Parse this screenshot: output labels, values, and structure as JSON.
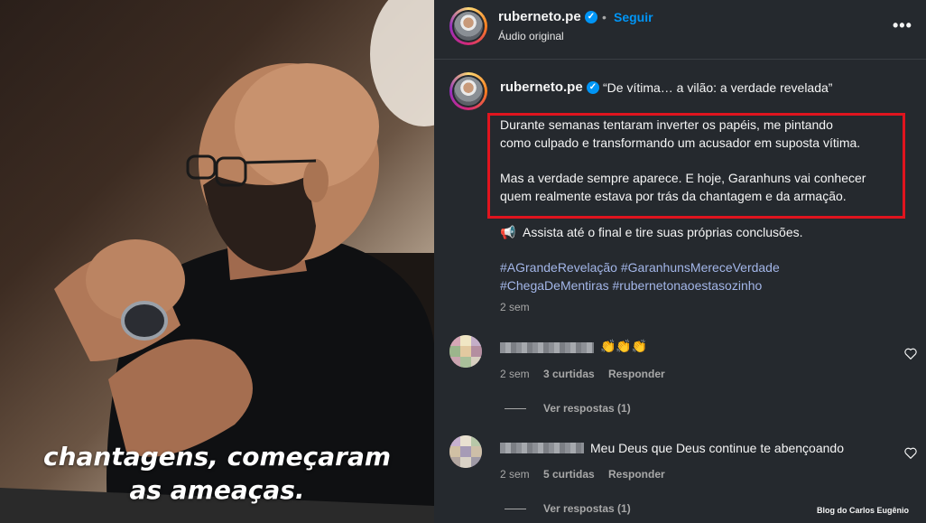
{
  "video": {
    "caption_line1": "chantagens, começaram",
    "caption_line2": "as ameaças."
  },
  "header": {
    "username": "ruberneto.pe",
    "verified_icon": "verified-badge-icon",
    "separator": "•",
    "follow_label": "Seguir",
    "audio_label": "Áudio original",
    "more_label": "•••"
  },
  "post": {
    "username": "ruberneto.pe",
    "title": "“De vítima… a vilão: a verdade revelada”",
    "paragraph1_line1": "Durante semanas tentaram inverter os papéis, me pintando",
    "paragraph1_line2": "como culpado e transformando um acusador em suposta vítima.",
    "paragraph2_line1": "Mas a verdade sempre aparece. E hoje, Garanhuns vai conhecer",
    "paragraph2_line2": "quem realmente estava por trás da chantagem e da armação.",
    "megaphone_icon": "📢",
    "cta": "Assista até o final e tire suas próprias conclusões.",
    "hashtags_line1": "#AGrandeRevelação #GaranhunsMereceVerdade",
    "hashtags_line2": "#ChegaDeMentiras #rubernetonaoestasozinho",
    "time": "2 sem",
    "highlight_color": "#e0141e"
  },
  "comments": [
    {
      "text": "👏👏👏",
      "time": "2 sem",
      "likes": "3 curtidas",
      "reply_label": "Responder",
      "view_replies": "Ver respostas (1)"
    },
    {
      "text": "Meu Deus que Deus continue te abençoando",
      "time": "2 sem",
      "likes": "5 curtidas",
      "reply_label": "Responder",
      "view_replies": "Ver respostas (1)"
    }
  ],
  "watermark": "Blog do Carlos Eugênio",
  "colors": {
    "panel_bg": "#25292e",
    "accent": "#0095f6",
    "hashtag": "#a3b6e8"
  }
}
